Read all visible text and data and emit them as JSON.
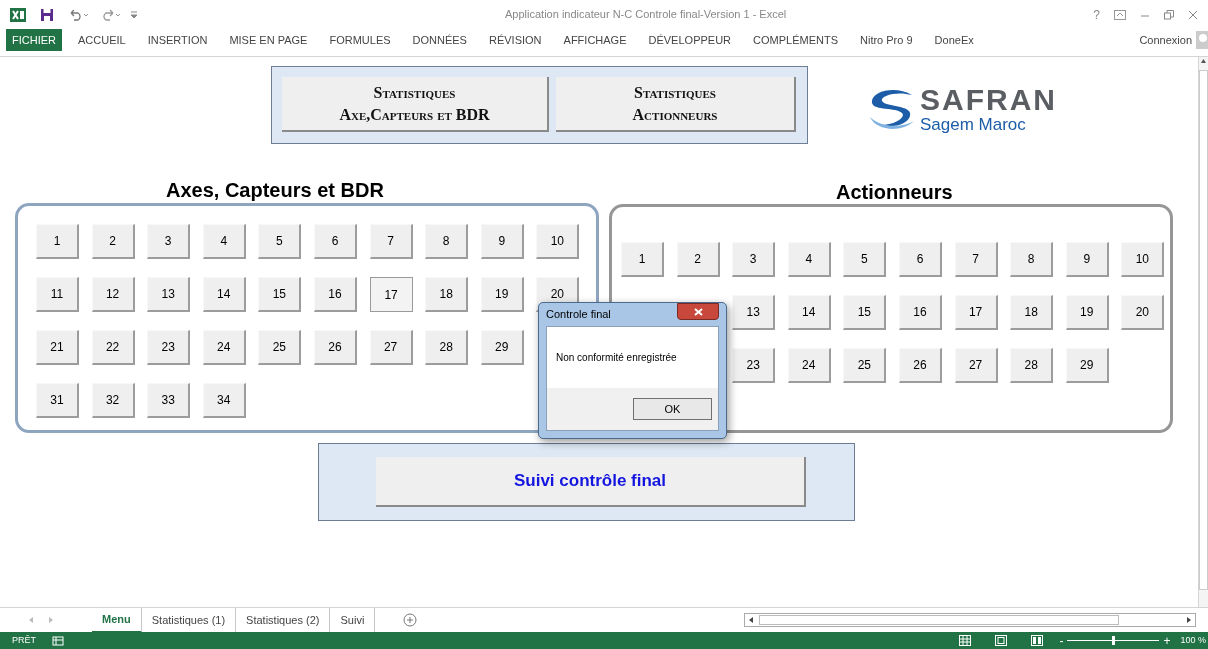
{
  "window": {
    "title": "Application indicateur N-C Controle final-Version 1 - Excel",
    "help": "?",
    "account": "Connexion"
  },
  "ribbon_tabs": [
    {
      "label": "FICHIER",
      "selected": true
    },
    {
      "label": "ACCUEIL",
      "selected": false
    },
    {
      "label": "INSERTION",
      "selected": false
    },
    {
      "label": "MISE EN PAGE",
      "selected": false
    },
    {
      "label": "FORMULES",
      "selected": false
    },
    {
      "label": "DONNÉES",
      "selected": false
    },
    {
      "label": "RÉVISION",
      "selected": false
    },
    {
      "label": "AFFICHAGE",
      "selected": false
    },
    {
      "label": "DÉVELOPPEUR",
      "selected": false
    },
    {
      "label": "COMPLÉMENTS",
      "selected": false
    },
    {
      "label": "Nitro Pro 9",
      "selected": false
    },
    {
      "label": "DoneEx",
      "selected": false
    }
  ],
  "stats_buttons": [
    {
      "lines": [
        "Statistiques",
        "Axe,Capteurs et BDR"
      ]
    },
    {
      "lines": [
        "Statistiques",
        "Actionneurs"
      ]
    }
  ],
  "logo": {
    "brand": "SAFRAN",
    "subtitle": "Sagem Maroc"
  },
  "groups": [
    {
      "title": "Axes, Capteurs et BDR",
      "rows": [
        [
          {
            "label": "1",
            "selected": false
          },
          {
            "label": "2",
            "selected": false
          },
          {
            "label": "3",
            "selected": false
          },
          {
            "label": "4",
            "selected": false
          },
          {
            "label": "5",
            "selected": false
          },
          {
            "label": "6",
            "selected": false
          },
          {
            "label": "7",
            "selected": false
          },
          {
            "label": "8",
            "selected": false
          },
          {
            "label": "9",
            "selected": false
          },
          {
            "label": "10",
            "selected": false
          }
        ],
        [
          {
            "label": "11",
            "selected": false
          },
          {
            "label": "12",
            "selected": false
          },
          {
            "label": "13",
            "selected": false
          },
          {
            "label": "14",
            "selected": false
          },
          {
            "label": "15",
            "selected": false
          },
          {
            "label": "16",
            "selected": false
          },
          {
            "label": "17",
            "selected": true
          },
          {
            "label": "18",
            "selected": false
          },
          {
            "label": "19",
            "selected": false
          },
          {
            "label": "20",
            "selected": false
          }
        ],
        [
          {
            "label": "21",
            "selected": false
          },
          {
            "label": "22",
            "selected": false
          },
          {
            "label": "23",
            "selected": false
          },
          {
            "label": "24",
            "selected": false
          },
          {
            "label": "25",
            "selected": false
          },
          {
            "label": "26",
            "selected": false
          },
          {
            "label": "27",
            "selected": false
          },
          {
            "label": "28",
            "selected": false
          },
          {
            "label": "29",
            "selected": false
          },
          {
            "kind": "covered"
          }
        ],
        [
          {
            "label": "31",
            "selected": false
          },
          {
            "label": "32",
            "selected": false
          },
          {
            "label": "33",
            "selected": false
          },
          {
            "label": "34",
            "selected": false
          }
        ]
      ]
    },
    {
      "title": "Actionneurs",
      "rows": [
        [
          {
            "label": "1",
            "selected": false
          },
          {
            "label": "2",
            "selected": false
          },
          {
            "label": "3",
            "selected": false
          },
          {
            "label": "4",
            "selected": false
          },
          {
            "label": "5",
            "selected": false
          },
          {
            "label": "6",
            "selected": false
          },
          {
            "label": "7",
            "selected": false
          },
          {
            "label": "8",
            "selected": false
          },
          {
            "label": "9",
            "selected": false
          },
          {
            "label": "10",
            "selected": false
          }
        ],
        [
          {
            "kind": "covered"
          },
          {
            "kind": "covered"
          },
          {
            "label": "13",
            "selected": false
          },
          {
            "label": "14",
            "selected": false
          },
          {
            "label": "15",
            "selected": false
          },
          {
            "label": "16",
            "selected": false
          },
          {
            "label": "17",
            "selected": false
          },
          {
            "label": "18",
            "selected": false
          },
          {
            "label": "19",
            "selected": false
          },
          {
            "label": "20",
            "selected": false
          }
        ],
        [
          {
            "kind": "covered"
          },
          {
            "kind": "covered"
          },
          {
            "label": "23",
            "selected": false
          },
          {
            "label": "24",
            "selected": false
          },
          {
            "label": "25",
            "selected": false
          },
          {
            "label": "26",
            "selected": false
          },
          {
            "label": "27",
            "selected": false
          },
          {
            "label": "28",
            "selected": false
          },
          {
            "label": "29",
            "selected": false
          }
        ]
      ]
    }
  ],
  "follow_button": "Suivi contrôle final",
  "dialog": {
    "title": "Controle final",
    "message": "Non conformité enregistrée",
    "button": "OK"
  },
  "sheet_tabs": [
    {
      "label": "Menu",
      "selected": true
    },
    {
      "label": "Statistiques (1)",
      "selected": false
    },
    {
      "label": "Statistiques (2)",
      "selected": false
    },
    {
      "label": "Suivi",
      "selected": false
    }
  ],
  "status_bar": {
    "status": "PRÊT",
    "zoom": {
      "out": "-",
      "in": "+",
      "level": 0.5,
      "reading": "100 %"
    }
  }
}
